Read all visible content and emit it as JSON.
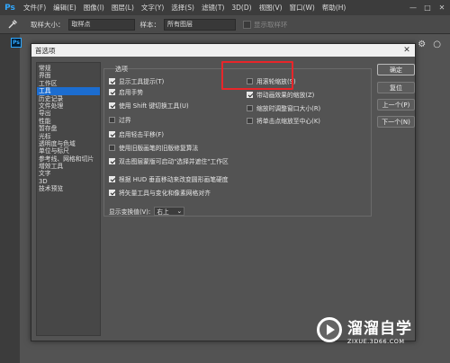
{
  "app": {
    "logo": "Ps",
    "menus": [
      "文件(F)",
      "编辑(E)",
      "图像(I)",
      "图层(L)",
      "文字(Y)",
      "选择(S)",
      "滤镜(T)",
      "3D(D)",
      "视图(V)",
      "窗口(W)",
      "帮助(H)"
    ],
    "window_controls": [
      "—",
      "□",
      "✕"
    ]
  },
  "options_bar": {
    "tool_icon": "eyedropper-icon",
    "sample_size_label": "取样大小：",
    "sample_size_value": "取样点",
    "sample_label": "样本：",
    "sample_value": "所有图层",
    "show_ring_label": "显示取样环"
  },
  "panel_icon": "Ps",
  "dialog": {
    "title": "首选项",
    "close": "✕",
    "nav_items": [
      "常规",
      "界面",
      "工作区",
      "工具",
      "历史记录",
      "文件处理",
      "导出",
      "性能",
      "暂存盘",
      "光标",
      "透明度与色域",
      "单位与标尺",
      "参考线、网格和切片",
      "增效工具",
      "文字",
      "3D",
      "技术预览"
    ],
    "nav_selected_index": 3,
    "group_title": "选项",
    "options_left": [
      {
        "label": "显示工具提示(T)",
        "checked": true
      },
      {
        "label": "启用手势",
        "checked": true
      },
      {
        "label": "使用 Shift 键切换工具(U)",
        "checked": true
      },
      {
        "label": "过界",
        "checked": false
      },
      {
        "label": "启用轻击平移(F)",
        "checked": true
      },
      {
        "label": "使用旧版画笔的旧版修复算法",
        "checked": false
      },
      {
        "label": "双击图层蒙版可启动\"选择并遮住\"工作区",
        "checked": true
      },
      {
        "label": "根据 HUD 垂直移动来改变圆形画笔硬度",
        "checked": true
      },
      {
        "label": "将矢量工具与变化和像素网格对齐",
        "checked": true
      }
    ],
    "options_right": [
      {
        "label": "用滚轮缩放(S)",
        "checked": false
      },
      {
        "label": "带动画效果的缩放(Z)",
        "checked": true
      },
      {
        "label": "缩放时调整窗口大小(R)",
        "checked": false
      },
      {
        "label": "将单击点缩放至中心(K)",
        "checked": false
      }
    ],
    "language_label": "显示变换值(V):",
    "language_value": "右上",
    "buttons": {
      "ok": "确定",
      "reset": "复位",
      "prev": "上一个(P)",
      "next": "下一个(N)"
    }
  },
  "highlight_color": "#e8262a",
  "watermark": {
    "title": "溜溜自学",
    "url": "ZIXUE.3D66.COM"
  }
}
